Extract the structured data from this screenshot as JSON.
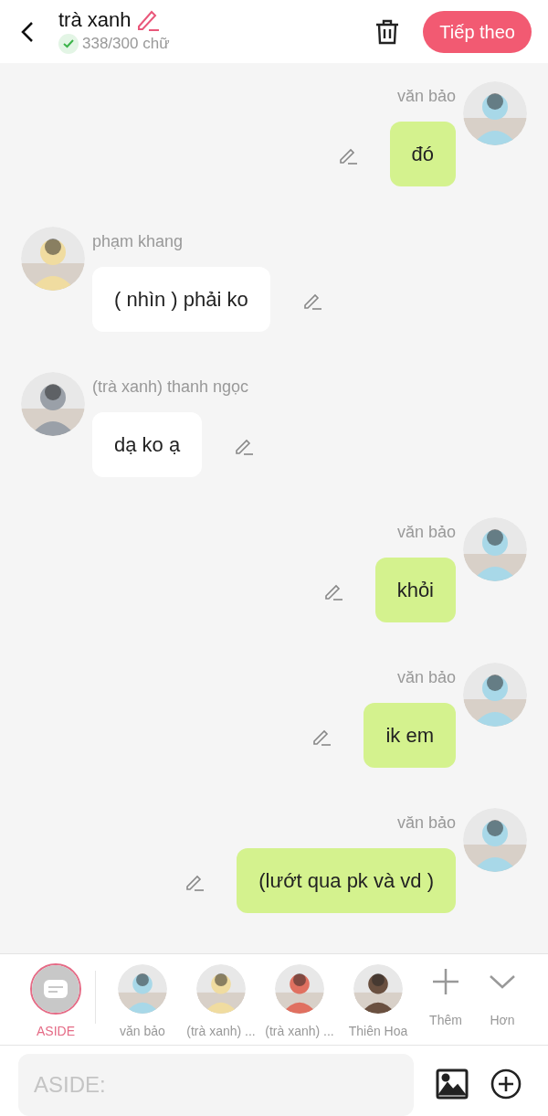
{
  "header": {
    "title": "trà xanh",
    "counter": "338/300 chữ",
    "counter_ok": true,
    "next_button": "Tiếp theo"
  },
  "messages": [
    {
      "kind": "me",
      "name": "văn bảo",
      "text": "đó"
    },
    {
      "kind": "other",
      "name": "phạm khang",
      "text": "( nhìn ) phải ko"
    },
    {
      "kind": "other",
      "name": "(trà xanh) thanh ngọc",
      "text": "dạ ko ạ"
    },
    {
      "kind": "me",
      "name": "văn bảo",
      "text": "khỏi"
    },
    {
      "kind": "me",
      "name": "văn bảo",
      "text": "ik em"
    },
    {
      "kind": "me",
      "name": "văn bảo",
      "text": "(lướt qua pk và vd )"
    }
  ],
  "characters": [
    {
      "kind": "aside",
      "label": "ASIDE",
      "selected": true
    },
    {
      "kind": "person",
      "label": "văn bảo",
      "selected": false
    },
    {
      "kind": "person",
      "label": "(trà xanh) ...",
      "selected": false
    },
    {
      "kind": "person",
      "label": "(trà xanh) ...",
      "selected": false
    },
    {
      "kind": "person",
      "label": "Thiên Hoa",
      "selected": false
    },
    {
      "kind": "add",
      "label": "Thêm",
      "selected": false
    },
    {
      "kind": "more",
      "label": "Hơn",
      "selected": false
    }
  ],
  "input": {
    "placeholder": "ASIDE:"
  }
}
